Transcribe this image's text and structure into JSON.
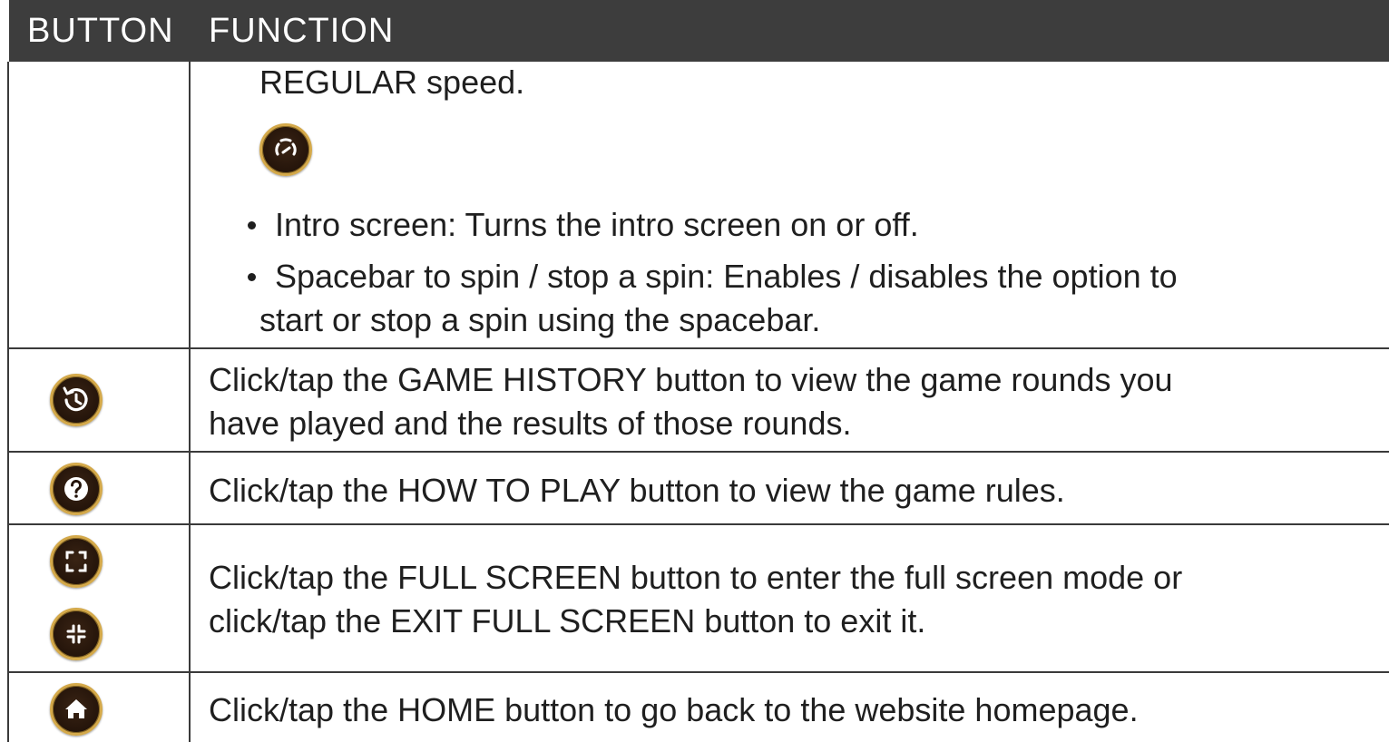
{
  "header": {
    "col_button": "BUTTON",
    "col_function": "FUNCTION"
  },
  "rows": {
    "settings_cont": {
      "line1": "REGULAR speed.",
      "icon": "turbo-speed-icon",
      "bullet1": "Intro screen: Turns the intro screen on or off.",
      "bullet2_line1": "Spacebar to spin / stop a spin: Enables / disables the option to",
      "bullet2_line2": "start or stop a spin using the spacebar."
    },
    "history": {
      "icon": "game-history-icon",
      "line1": "Click/tap the GAME HISTORY button to view the game rounds you",
      "line2": "have played and the results of those rounds."
    },
    "howto": {
      "icon": "question-icon",
      "line1": "Click/tap the HOW TO PLAY button to view the game rules."
    },
    "fullscreen": {
      "icon_enter": "full-screen-icon",
      "icon_exit": "exit-full-screen-icon",
      "line1": "Click/tap the FULL SCREEN button to enter the full screen mode or",
      "line2": "click/tap the EXIT FULL SCREEN button to exit it."
    },
    "home": {
      "icon": "home-icon",
      "line1": "Click/tap the HOME button to go back to the website homepage."
    }
  },
  "colors": {
    "header_bg": "#3d3d3d",
    "icon_bg": "#24140a",
    "icon_ring": "#d4a94a",
    "grid_line": "#3a3a3a"
  }
}
